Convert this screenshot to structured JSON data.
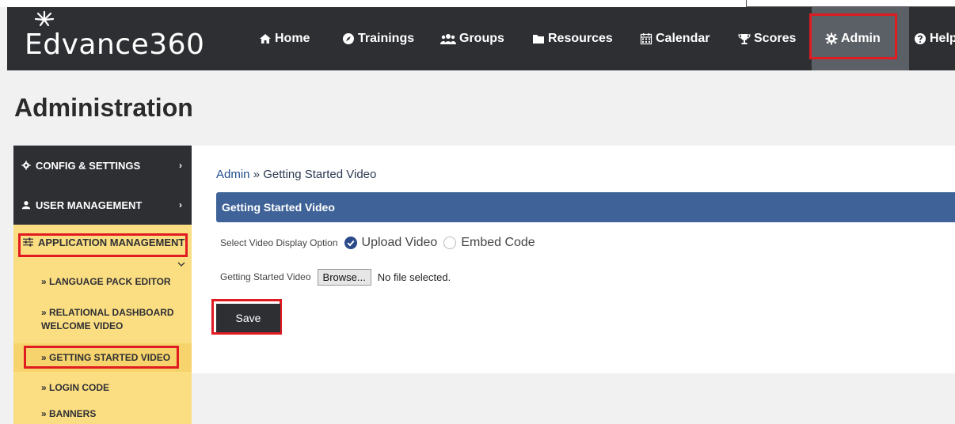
{
  "brand": {
    "name": "Edvance360",
    "accent": "#fcde82",
    "nav_bg": "#2e2f33",
    "header_bg": "#3f6398",
    "highlight": "#e01b22"
  },
  "nav": {
    "items": [
      {
        "label": "Home",
        "icon": "home-icon"
      },
      {
        "label": "Trainings",
        "icon": "compass-icon"
      },
      {
        "label": "Groups",
        "icon": "users-icon"
      },
      {
        "label": "Resources",
        "icon": "folder-icon"
      },
      {
        "label": "Calendar",
        "icon": "calendar-icon"
      },
      {
        "label": "Scores",
        "icon": "trophy-icon"
      },
      {
        "label": "Admin",
        "icon": "gear-icon",
        "active": true
      },
      {
        "label": "Help",
        "icon": "question-icon"
      }
    ]
  },
  "page": {
    "title": "Administration"
  },
  "sidebar": {
    "config": "CONFIG & SETTINGS",
    "users": "USER MANAGEMENT",
    "app": "APPLICATION MANAGEMENT",
    "sub_items": [
      {
        "label": "» LANGUAGE PACK EDITOR"
      },
      {
        "label": "» RELATIONAL DASHBOARD WELCOME VIDEO"
      },
      {
        "label": "» GETTING STARTED VIDEO",
        "active": true
      },
      {
        "label": "» LOGIN CODE"
      },
      {
        "label": "» BANNERS"
      }
    ]
  },
  "main": {
    "breadcrumb_root": "Admin",
    "breadcrumb_sep": " » ",
    "breadcrumb_current": "Getting Started Video",
    "section_title": "Getting Started Video",
    "display_option_label": "Select Video Display Option",
    "option_upload": "Upload Video",
    "option_embed": "Embed Code",
    "file_label": "Getting Started Video",
    "browse_label": "Browse...",
    "file_status": "No file selected.",
    "save_label": "Save"
  }
}
